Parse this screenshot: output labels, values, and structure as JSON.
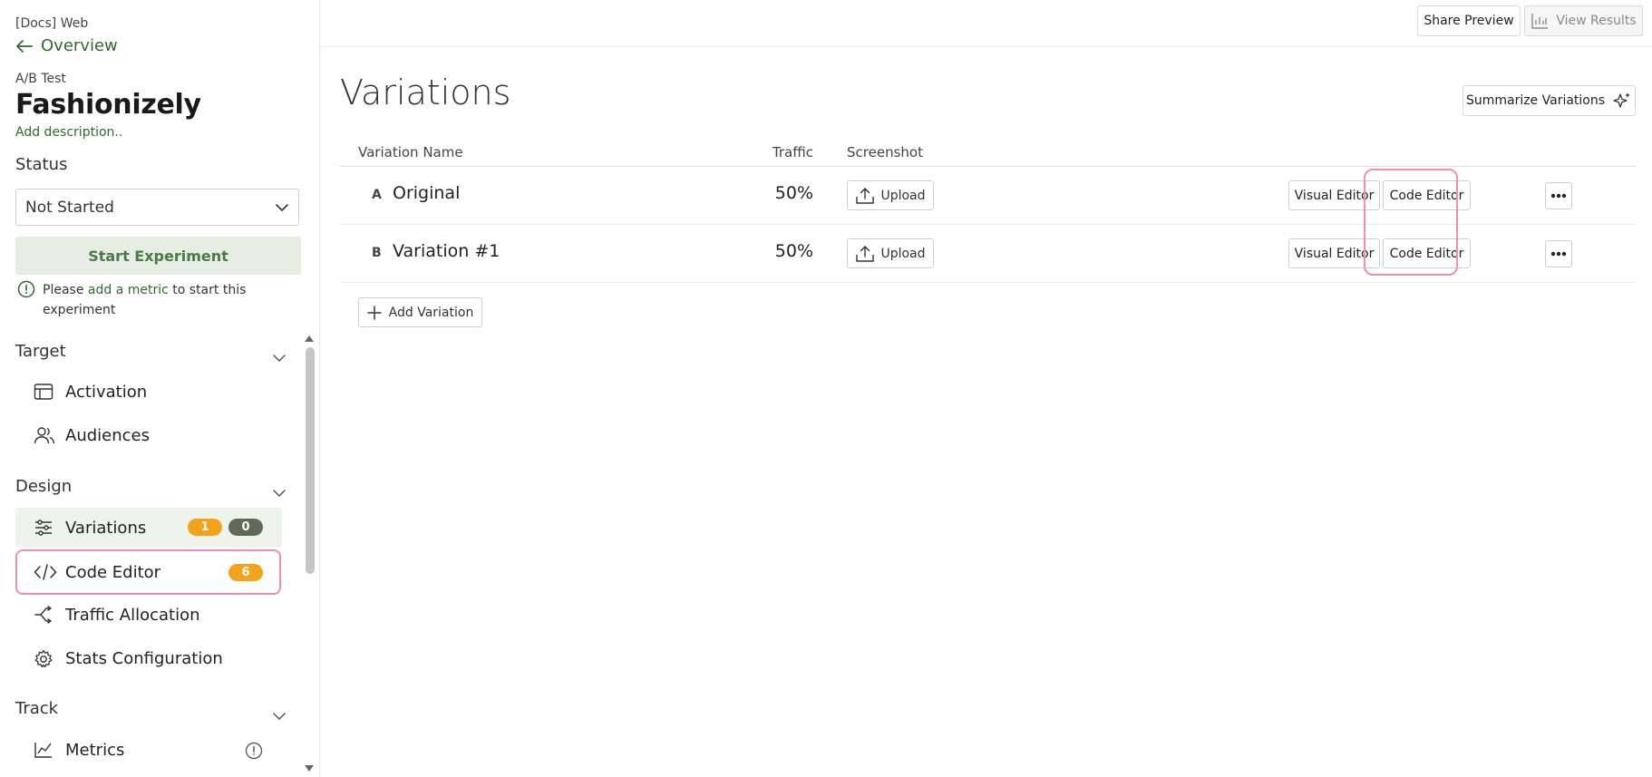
{
  "sidebar": {
    "project": "[Docs] Web",
    "back_label": "Overview",
    "experiment_type": "A/B Test",
    "experiment_name": "Fashionizely",
    "add_description": "Add description..",
    "status_label": "Status",
    "status_value": "Not Started",
    "start_button": "Start Experiment",
    "warning": {
      "pre": "Please",
      "link": "add a metric",
      "post": "to start this experiment"
    },
    "sections": {
      "target": {
        "title": "Target",
        "items": [
          {
            "label": "Activation"
          },
          {
            "label": "Audiences"
          }
        ]
      },
      "design": {
        "title": "Design",
        "items": [
          {
            "label": "Variations",
            "badges": [
              "1",
              "0"
            ]
          },
          {
            "label": "Code Editor",
            "badges": [
              "6"
            ]
          },
          {
            "label": "Traffic Allocation"
          },
          {
            "label": "Stats Configuration"
          }
        ]
      },
      "track": {
        "title": "Track",
        "items": [
          {
            "label": "Metrics"
          }
        ]
      }
    }
  },
  "topbar": {
    "share_preview": "Share Preview",
    "view_results": "View Results"
  },
  "main": {
    "title": "Variations",
    "summarize_button": "Summarize Variations",
    "table": {
      "headers": {
        "name": "Variation Name",
        "traffic": "Traffic",
        "screenshot": "Screenshot"
      },
      "rows": [
        {
          "letter": "A",
          "name": "Original",
          "traffic": "50%",
          "upload": "Upload",
          "visual_editor": "Visual Editor",
          "code_editor": "Code Editor"
        },
        {
          "letter": "B",
          "name": "Variation #1",
          "traffic": "50%",
          "upload": "Upload",
          "visual_editor": "Visual Editor",
          "code_editor": "Code Editor"
        }
      ]
    },
    "add_variation": "Add Variation"
  },
  "colors": {
    "brand_green": "#2f6b2a",
    "badge_orange": "#f3a21b",
    "badge_dark": "#5f6a59",
    "highlight_pink": "#f08fb6"
  }
}
